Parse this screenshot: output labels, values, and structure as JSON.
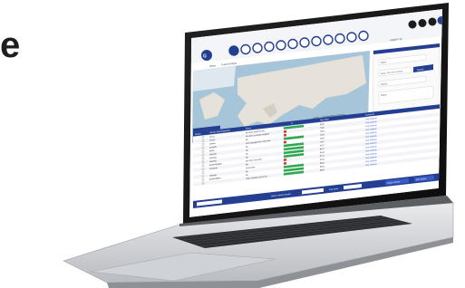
{
  "headline_fragment": "e",
  "laptop": {
    "screen": {
      "tabs": [
        "Home",
        "Track & Report"
      ],
      "account_text": "Logged in as",
      "map_attribution": "Leaflet | © OpenStreetMap contributors",
      "search_form": {
        "fields": [
          "Name",
          "Name, VIN, Driver Number",
          "Sensor",
          "Status"
        ],
        "search_button": "Search"
      },
      "table": {
        "columns": [
          "Status",
          "Vehicle Name/Number",
          "Driver",
          "%",
          "Reg Mark",
          "Comment"
        ],
        "rows": [
          {
            "name": "Driver",
            "driver": "No driver listed for this",
            "reg": "MOS",
            "comment": "View Address"
          },
          {
            "name": "DT750",
            "driver": "No driver currently assigned",
            "reg": "7326",
            "comment": "View Address"
          },
          {
            "name": "Gemini",
            "driver": "No",
            "reg": "7323",
            "comment": "View Address"
          },
          {
            "name": "Lancelot",
            "driver": "Driver assigned for CAN Fuel",
            "reg": "7324",
            "comment": "View Address"
          },
          {
            "name": "NG85",
            "driver": "No",
            "reg": "7325",
            "comment": "View Address"
          },
          {
            "name": "Veranda",
            "driver": "No",
            "reg": "7327",
            "comment": "View Address"
          },
          {
            "name": "Veranda",
            "driver": "No",
            "reg": "8707",
            "comment": "View Address"
          },
          {
            "name": "Veranda",
            "driver": "No",
            "reg": "8417",
            "comment": "View Address"
          },
          {
            "name": "BGRRR09B8A",
            "driver": "NA VIN? no on this",
            "reg": "8543",
            "comment": "View Address"
          },
          {
            "name": "Lancaster",
            "driver": "No",
            "reg": "8714",
            "comment": "View Address"
          },
          {
            "name": "",
            "driver": "Driver Sam",
            "reg": "8719",
            "comment": "View Address"
          },
          {
            "name": "Veranda",
            "driver": "No",
            "reg": "8844",
            "comment": "View Address"
          },
          {
            "name": "BGRRR0B8A",
            "driver": "No",
            "reg": "8845",
            "comment": "View Address"
          },
          {
            "name": "",
            "driver": "Other Vehicle & Driver for",
            "reg": "8854",
            "comment": "View Address"
          }
        ]
      },
      "footer": {
        "label_1": "Select Vehicle Number",
        "label_2": "Fuel Level",
        "button_1": "Assign Vehicle",
        "button_2": "Edit Vehicle"
      }
    }
  },
  "colors": {
    "accent_blue": "#243f91",
    "bar_green": "#2fa84f",
    "bar_red": "#d93535",
    "map_land": "#e6e2da",
    "map_water": "#a7c5d9"
  }
}
